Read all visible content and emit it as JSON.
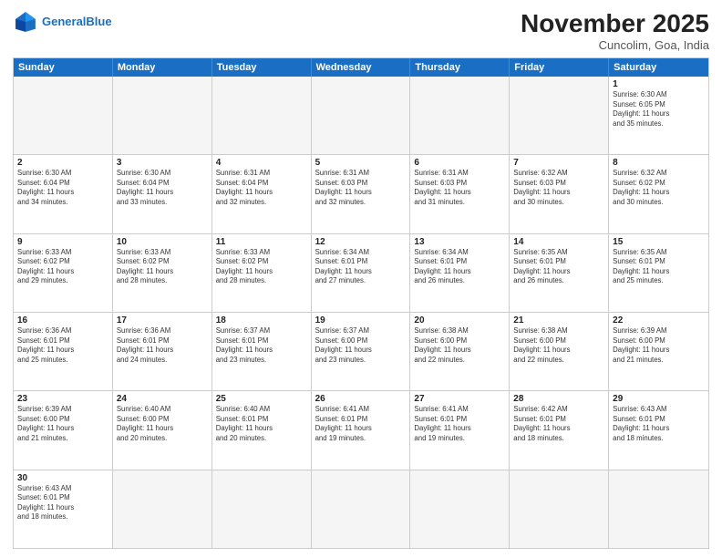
{
  "header": {
    "logo_general": "General",
    "logo_blue": "Blue",
    "month_title": "November 2025",
    "location": "Cuncolim, Goa, India"
  },
  "days": [
    "Sunday",
    "Monday",
    "Tuesday",
    "Wednesday",
    "Thursday",
    "Friday",
    "Saturday"
  ],
  "weeks": [
    [
      {
        "date": "",
        "info": ""
      },
      {
        "date": "",
        "info": ""
      },
      {
        "date": "",
        "info": ""
      },
      {
        "date": "",
        "info": ""
      },
      {
        "date": "",
        "info": ""
      },
      {
        "date": "",
        "info": ""
      },
      {
        "date": "1",
        "info": "Sunrise: 6:30 AM\nSunset: 6:05 PM\nDaylight: 11 hours\nand 35 minutes."
      }
    ],
    [
      {
        "date": "2",
        "info": "Sunrise: 6:30 AM\nSunset: 6:04 PM\nDaylight: 11 hours\nand 34 minutes."
      },
      {
        "date": "3",
        "info": "Sunrise: 6:30 AM\nSunset: 6:04 PM\nDaylight: 11 hours\nand 33 minutes."
      },
      {
        "date": "4",
        "info": "Sunrise: 6:31 AM\nSunset: 6:04 PM\nDaylight: 11 hours\nand 32 minutes."
      },
      {
        "date": "5",
        "info": "Sunrise: 6:31 AM\nSunset: 6:03 PM\nDaylight: 11 hours\nand 32 minutes."
      },
      {
        "date": "6",
        "info": "Sunrise: 6:31 AM\nSunset: 6:03 PM\nDaylight: 11 hours\nand 31 minutes."
      },
      {
        "date": "7",
        "info": "Sunrise: 6:32 AM\nSunset: 6:03 PM\nDaylight: 11 hours\nand 30 minutes."
      },
      {
        "date": "8",
        "info": "Sunrise: 6:32 AM\nSunset: 6:02 PM\nDaylight: 11 hours\nand 30 minutes."
      }
    ],
    [
      {
        "date": "9",
        "info": "Sunrise: 6:33 AM\nSunset: 6:02 PM\nDaylight: 11 hours\nand 29 minutes."
      },
      {
        "date": "10",
        "info": "Sunrise: 6:33 AM\nSunset: 6:02 PM\nDaylight: 11 hours\nand 28 minutes."
      },
      {
        "date": "11",
        "info": "Sunrise: 6:33 AM\nSunset: 6:02 PM\nDaylight: 11 hours\nand 28 minutes."
      },
      {
        "date": "12",
        "info": "Sunrise: 6:34 AM\nSunset: 6:01 PM\nDaylight: 11 hours\nand 27 minutes."
      },
      {
        "date": "13",
        "info": "Sunrise: 6:34 AM\nSunset: 6:01 PM\nDaylight: 11 hours\nand 26 minutes."
      },
      {
        "date": "14",
        "info": "Sunrise: 6:35 AM\nSunset: 6:01 PM\nDaylight: 11 hours\nand 26 minutes."
      },
      {
        "date": "15",
        "info": "Sunrise: 6:35 AM\nSunset: 6:01 PM\nDaylight: 11 hours\nand 25 minutes."
      }
    ],
    [
      {
        "date": "16",
        "info": "Sunrise: 6:36 AM\nSunset: 6:01 PM\nDaylight: 11 hours\nand 25 minutes."
      },
      {
        "date": "17",
        "info": "Sunrise: 6:36 AM\nSunset: 6:01 PM\nDaylight: 11 hours\nand 24 minutes."
      },
      {
        "date": "18",
        "info": "Sunrise: 6:37 AM\nSunset: 6:01 PM\nDaylight: 11 hours\nand 23 minutes."
      },
      {
        "date": "19",
        "info": "Sunrise: 6:37 AM\nSunset: 6:00 PM\nDaylight: 11 hours\nand 23 minutes."
      },
      {
        "date": "20",
        "info": "Sunrise: 6:38 AM\nSunset: 6:00 PM\nDaylight: 11 hours\nand 22 minutes."
      },
      {
        "date": "21",
        "info": "Sunrise: 6:38 AM\nSunset: 6:00 PM\nDaylight: 11 hours\nand 22 minutes."
      },
      {
        "date": "22",
        "info": "Sunrise: 6:39 AM\nSunset: 6:00 PM\nDaylight: 11 hours\nand 21 minutes."
      }
    ],
    [
      {
        "date": "23",
        "info": "Sunrise: 6:39 AM\nSunset: 6:00 PM\nDaylight: 11 hours\nand 21 minutes."
      },
      {
        "date": "24",
        "info": "Sunrise: 6:40 AM\nSunset: 6:00 PM\nDaylight: 11 hours\nand 20 minutes."
      },
      {
        "date": "25",
        "info": "Sunrise: 6:40 AM\nSunset: 6:01 PM\nDaylight: 11 hours\nand 20 minutes."
      },
      {
        "date": "26",
        "info": "Sunrise: 6:41 AM\nSunset: 6:01 PM\nDaylight: 11 hours\nand 19 minutes."
      },
      {
        "date": "27",
        "info": "Sunrise: 6:41 AM\nSunset: 6:01 PM\nDaylight: 11 hours\nand 19 minutes."
      },
      {
        "date": "28",
        "info": "Sunrise: 6:42 AM\nSunset: 6:01 PM\nDaylight: 11 hours\nand 18 minutes."
      },
      {
        "date": "29",
        "info": "Sunrise: 6:43 AM\nSunset: 6:01 PM\nDaylight: 11 hours\nand 18 minutes."
      }
    ],
    [
      {
        "date": "30",
        "info": "Sunrise: 6:43 AM\nSunset: 6:01 PM\nDaylight: 11 hours\nand 18 minutes."
      },
      {
        "date": "",
        "info": ""
      },
      {
        "date": "",
        "info": ""
      },
      {
        "date": "",
        "info": ""
      },
      {
        "date": "",
        "info": ""
      },
      {
        "date": "",
        "info": ""
      },
      {
        "date": "",
        "info": ""
      }
    ]
  ]
}
